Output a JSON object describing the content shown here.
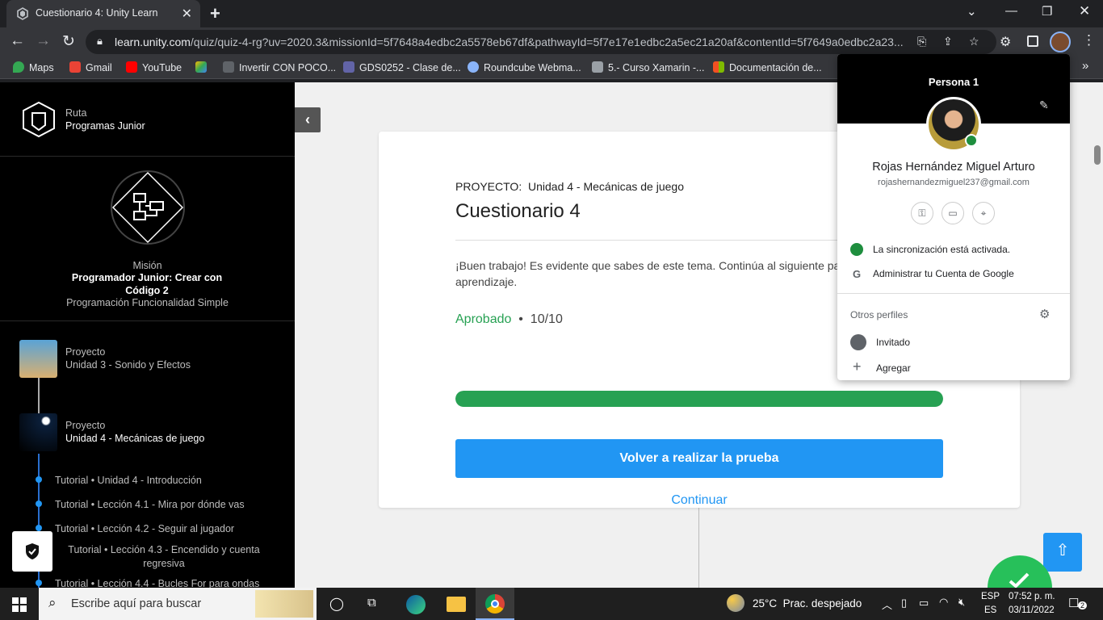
{
  "browser": {
    "tab_title": "Cuestionario 4: Unity Learn",
    "url_host": "learn.unity.com",
    "url_path": "/quiz/quiz-4-rg?uv=2020.3&missionId=5f7648a4edbc2a5578eb67df&pathwayId=5f7e17e1edbc2a5ec21a20af&contentId=5f7649a0edbc2a23...",
    "bookmarks": [
      {
        "label": "Maps",
        "color": "#34a853"
      },
      {
        "label": "Gmail",
        "color": "#ea4335"
      },
      {
        "label": "YouTube",
        "color": "#ff0000"
      },
      {
        "label": "",
        "color": "#fbbc04"
      },
      {
        "label": "Invertir CON POCO...",
        "color": "#5f6368"
      },
      {
        "label": "GDS0252 - Clase de...",
        "color": "#6264a7"
      },
      {
        "label": "Roundcube Webma...",
        "color": "#8ab4f8"
      },
      {
        "label": "5.- Curso Xamarin -...",
        "color": "#9aa0a6"
      },
      {
        "label": "Documentación de...",
        "color": "#f25022"
      }
    ]
  },
  "sidebar": {
    "route_label": "Ruta",
    "route_name": "Programas Junior",
    "mission_label": "Misión",
    "mission_title": "Programador Junior: Crear con Código 2",
    "mission_subtitle": "Programación Funcionalidad Simple",
    "projects": [
      {
        "label": "Proyecto",
        "name": "Unidad 3 - Sonido y Efectos"
      },
      {
        "label": "Proyecto",
        "name": "Unidad 4 - Mecánicas de juego"
      }
    ],
    "tutorials": [
      "Tutorial • Unidad 4 - Introducción",
      "Tutorial • Lección 4.1 - Mira por dónde vas",
      "Tutorial • Lección 4.2 - Seguir al jugador",
      "Tutorial • Lección 4.3 - Encendido y cuenta regresiva",
      "Tutorial • Lección 4.4 - Bucles For para ondas"
    ]
  },
  "quiz": {
    "project_label": "PROYECTO:",
    "project_name": "Unidad 4 - Mecánicas de juego",
    "title": "Cuestionario 4",
    "message": "¡Buen trabajo! Es evidente que sabes de este tema. Continúa al siguiente paso en tu camino de aprendizaje.",
    "status": "Aprobado",
    "score": "10/10",
    "progress": 1.0,
    "retake_label": "Volver a realizar la prueba",
    "continue_label": "Continuar"
  },
  "profile": {
    "header": "Persona 1",
    "name": "Rojas Hernández Miguel Arturo",
    "email": "rojashernandezmiguel237@gmail.com",
    "sync_status": "La sincronización está activada.",
    "manage_account": "Administrar tu Cuenta de Google",
    "other_profiles": "Otros perfiles",
    "guest": "Invitado",
    "add": "Agregar"
  },
  "taskbar": {
    "search_placeholder": "Escribe aquí para buscar",
    "weather": "25°C  Prac. despejado",
    "lang_top": "ESP",
    "lang_bottom": "ES",
    "time": "07:52 p. m.",
    "date": "03/11/2022",
    "notifications": "2"
  },
  "colors": {
    "accent_blue": "#2196f3",
    "pass_green": "#27a153"
  }
}
